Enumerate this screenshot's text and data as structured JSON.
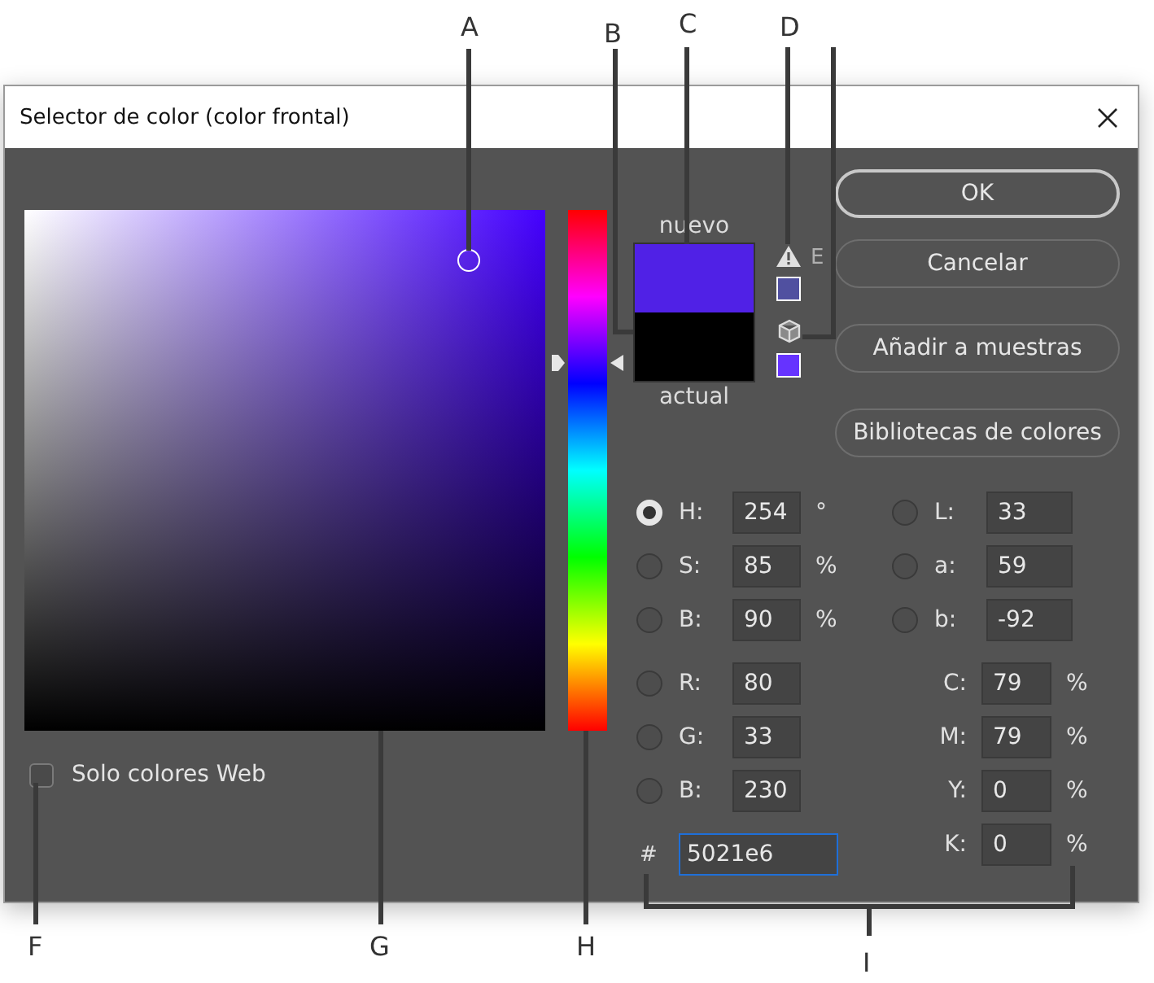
{
  "window": {
    "title": "Selector de color (color frontal)"
  },
  "callouts": [
    {
      "label": "A"
    },
    {
      "label": "B"
    },
    {
      "label": "C"
    },
    {
      "label": "D"
    },
    {
      "label": "E"
    },
    {
      "label": "F"
    },
    {
      "label": "G"
    },
    {
      "label": "H"
    },
    {
      "label": "I"
    }
  ],
  "hue_slider": {
    "level": 0.706
  },
  "preview": {
    "new_label": "nuevo",
    "current_label": "actual"
  },
  "alerts": [
    {
      "kind": "gamut",
      "color": "#5050a0"
    },
    {
      "kind": "web",
      "color": "#6633ff"
    }
  ],
  "buttons": [
    {
      "label": "OK",
      "default": true
    },
    {
      "label": "Cancelar",
      "default": false
    },
    {
      "label": "Añadir a muestras",
      "default": false
    },
    {
      "label": "Bibliotecas de colores",
      "default": false
    }
  ],
  "fields_left": [
    {
      "kind": "radio",
      "label": "H:",
      "value": "254",
      "unit": "°",
      "selected": true
    },
    {
      "kind": "radio",
      "label": "S:",
      "value": "85",
      "unit": "%",
      "selected": false
    },
    {
      "kind": "radio",
      "label": "B:",
      "value": "90",
      "unit": "%",
      "selected": false
    },
    {
      "kind": "radio",
      "label": "R:",
      "value": "80",
      "selected": false
    },
    {
      "kind": "radio",
      "label": "G:",
      "value": "33",
      "selected": false
    },
    {
      "kind": "radio",
      "label": "B:",
      "value": "230",
      "selected": false
    },
    {
      "kind": "hex",
      "label": "#",
      "value": "5021e6",
      "focused": true
    }
  ],
  "fields_right": [
    {
      "kind": "radio",
      "label": "L:",
      "value": "33",
      "selected": false
    },
    {
      "kind": "radio",
      "label": "a:",
      "value": "59",
      "selected": false
    },
    {
      "kind": "radio",
      "label": "b:",
      "value": "-92",
      "selected": false
    },
    {
      "kind": "plain",
      "label": "C:",
      "value": "79",
      "unit": "%"
    },
    {
      "kind": "plain",
      "label": "M:",
      "value": "79",
      "unit": "%"
    },
    {
      "kind": "plain",
      "label": "Y:",
      "value": "0",
      "unit": "%"
    },
    {
      "kind": "plain",
      "label": "K:",
      "value": "0",
      "unit": "%"
    }
  ],
  "web_only": {
    "label": "Solo colores Web",
    "checked": false
  }
}
